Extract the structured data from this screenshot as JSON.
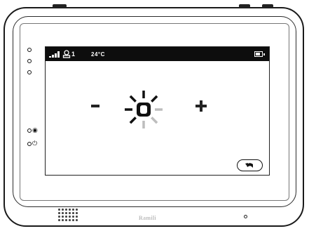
{
  "status_bar": {
    "signal_icon": "signal-bars-icon",
    "camera_icon": "camera-icon",
    "camera_number": "1",
    "temperature": "24°C",
    "battery_icon": "battery-icon",
    "battery_level": 0.8
  },
  "brightness": {
    "icon": "brightness-sun-icon",
    "decrease_icon": "minus-icon",
    "increase_icon": "plus-icon",
    "active_rays": 5,
    "total_rays": 8
  },
  "back_button": {
    "icon": "back-arrow-icon"
  },
  "side_indicators": {
    "eye_icon": "night-vision-icon",
    "power_icon": "power-icon"
  },
  "device": {
    "brand": "Ramili",
    "speaker_icon": "speaker-grille-icon",
    "mic_icon": "microphone-icon"
  },
  "colors": {
    "status_bar_bg": "#0d0d0d",
    "active_ray": "#111111",
    "inactive_ray": "#bdbdbd",
    "brand_text": "#bdbdbd"
  }
}
